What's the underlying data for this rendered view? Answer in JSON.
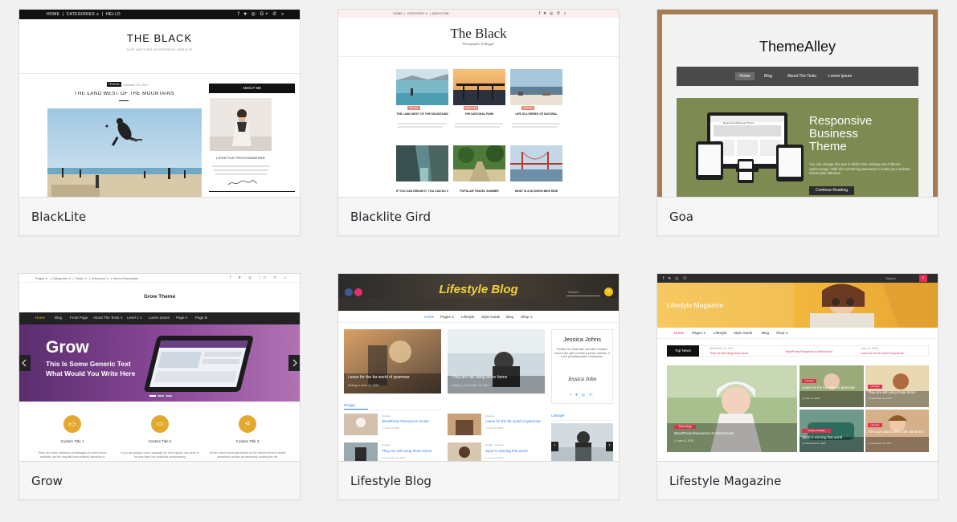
{
  "themes": [
    {
      "name": "BlackLite",
      "preview": {
        "topnav": [
          "HOME",
          "CATEGORIES ∨",
          "HELLO"
        ],
        "site_title": "THE BLACK",
        "tagline": "JUST ANOTHER WORDPRESS WEBSITE",
        "post_cat": "TRAVEL",
        "post_date": "October 10, 2017",
        "post_title": "THE LAND WEST OF THE MOUNTAINS",
        "about_title": "ABOUT ME",
        "about_caption": "LIFESTYLE PHOTOGRAPHER"
      }
    },
    {
      "name": "Blacklite Gird",
      "preview": {
        "site_title": "The Black",
        "tagline": "Photographer & Blogger",
        "posts": [
          "THE LAND WEST OF THE MOUNTAINS",
          "THE NATIONAL PARK",
          "LIFE IS A SERIES OF NATURAL",
          "IF YOU CAN DREAM IT, YOU CAN DO IT",
          "POPULAR TRAVEL SUMMER",
          "WHAT IS A 40,000KM BIKE RIDE"
        ],
        "cats": [
          "TRAVEL",
          "LIFESTYLE",
          "TRAVEL"
        ]
      }
    },
    {
      "name": "Goa",
      "preview": {
        "site_title": "ThemeAlley",
        "menu": [
          "Home",
          "Blog",
          "About The Tests",
          "Lorem Ipsum"
        ],
        "hero_title_1": "Responsive",
        "hero_title_2": "Business",
        "hero_title_3": "Theme",
        "hero_text": "You can change this text in Slider One settings tab of theme options page. With this something awesome to make your website ridiculously fabulous",
        "hero_button": "Continue Reading",
        "screen_text": "Responsive Business Theme"
      }
    },
    {
      "name": "Grow",
      "preview": {
        "topnav": [
          "Pages ∨",
          "Categories ∨",
          "Depth ∨",
          "Advanced ∨",
          "Menu Description"
        ],
        "site_title": "Grow Theme",
        "menu": [
          "Home",
          "Blog",
          "Front Page",
          "About The Tests ∨",
          "Level 1 ∨",
          "Lorem Ipsum",
          "Page A",
          "Page B"
        ],
        "hero_title": "Grow",
        "hero_sub_1": "This Is Some Generic Text",
        "hero_sub_2": "What Would You Write Here",
        "features": [
          "Custom Title 1",
          "Custom Title 2",
          "Custom Title 3"
        ],
        "feature_texts": [
          "There are many variations of passages of Lorem Ipsum available, but the majority have suffered alteration in",
          "If you are going to use a passage of Lorem Ipsum, you need to be sure there isn't anything embarrassing",
          "All the Lorem Ipsum generators on the Internet tend to repeat predefined chunks as necessary, making this the"
        ]
      }
    },
    {
      "name": "Lifestyle Blog",
      "preview": {
        "site_title": "Lifestyle Blog",
        "search_placeholder": "Search ...",
        "menu": [
          "Home",
          "Pages ∨",
          "Lifestyle",
          "Style Guide",
          "Blog",
          "Shop ∨"
        ],
        "card1_title": "Leave for the far world of grammar",
        "card1_meta": "theblog  ◷ June 11, 2018",
        "card2_title": "They are still using those farms",
        "card2_meta": "theblog  ◷ November 21, 2017",
        "author_name": "Jessica Johns",
        "author_bio": "Position is a distinctive and often constant trend in the style in which a person dresses. It is the prevailing styles in behaviour.",
        "author_sign": "Jessica John",
        "section_1": "Design",
        "section_2": "Lifestyle",
        "list": [
          "WordPress Resources at Site",
          "They are still using those farms",
          "Leave for the far world of grammar",
          "Sport is winning that world"
        ],
        "list_cats": [
          "Lifestyle",
          "Lifestyle",
          "Lifestyle",
          "Design · Fashion"
        ],
        "list_dates": [
          "◷ June 11, 2018",
          "◷ November 21, 2017",
          "◷ June 11, 2018",
          "◷ June 11, 2018"
        ]
      }
    },
    {
      "name": "Lifestyle Magazine",
      "preview": {
        "search_placeholder": "Search",
        "site_title": "Lifestyle Magazine",
        "menu": [
          "Home",
          "Pages ∨",
          "Lifestyle",
          "Style Guide",
          "Blog",
          "Shop ∨"
        ],
        "ticker_label": "Top News",
        "ticker": [
          "November 21, 2017",
          "They are still using those farms",
          "WordPress Resources at SiteGround",
          "June 11, 2018",
          "Leave for the far world of grammar"
        ],
        "main_cat": "Technology",
        "main_title": "WordPress Resources at SiteGround",
        "main_date": "◷ June 11, 2018",
        "tiles": [
          {
            "cat": "Lifestyle",
            "title": "Leave for the far world of grammar",
            "date": "◷ June 11, 2018"
          },
          {
            "cat": "Lifestyle",
            "title": "They are still using those farms",
            "date": "◷ November 21, 2017"
          },
          {
            "cat": "Design  Lifestyle",
            "title": "Sport is winning that world",
            "date": "◷ November 21, 2017"
          },
          {
            "cat": "Lifestyle",
            "title": "The copy warned the Little Blind text",
            "date": "◷ November 21, 2017"
          }
        ]
      }
    }
  ]
}
